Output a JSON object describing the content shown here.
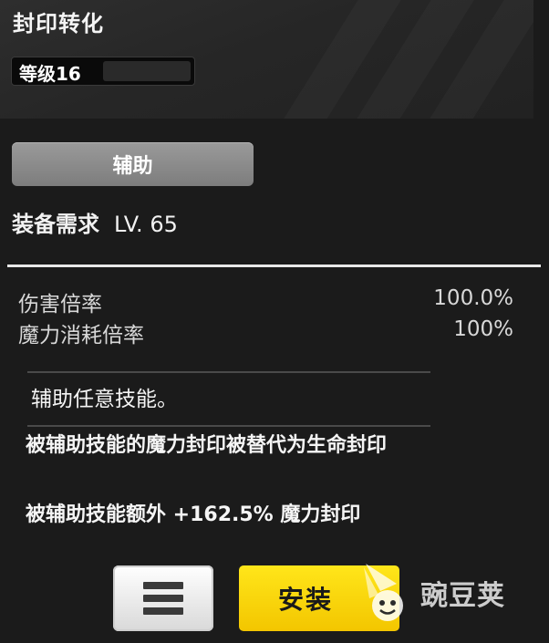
{
  "skill": {
    "title": "封印转化",
    "level_label": "等级16",
    "level_progress": 0.0,
    "category": "辅助",
    "requirement_label": "装备需求",
    "requirement_value": "LV. 65"
  },
  "stats": [
    {
      "label": "伤害倍率",
      "value": "100.0%"
    },
    {
      "label": "魔力消耗倍率",
      "value": "100%"
    }
  ],
  "description": "辅助任意技能。",
  "effects": [
    "被辅助技能的魔力封印被替代为生命封印",
    "被辅助技能额外 +162.5% 魔力封印"
  ],
  "actions": {
    "menu_icon": "hamburger-icon",
    "install_label": "安装"
  },
  "watermark": {
    "text": "豌豆荚",
    "icon": "pea-logo-icon"
  },
  "colors": {
    "background": "#1b1b1b",
    "category_badge": "#8a8a8a",
    "install_button": "#f7d20a",
    "menu_button": "#ececec"
  }
}
